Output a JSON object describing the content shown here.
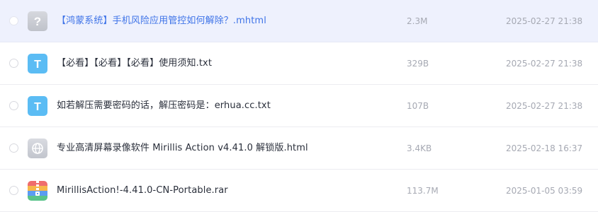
{
  "files": [
    {
      "name": "【鸿蒙系统】手机风险应用管控如何解除？.mhtml",
      "size": "2.3M",
      "date": "2025-02-27 21:38",
      "icon": "unknown-file-icon",
      "selected": true
    },
    {
      "name": "【必看】【必看】【必看】使用须知.txt",
      "size": "329B",
      "date": "2025-02-27 21:38",
      "icon": "text-file-icon",
      "selected": false
    },
    {
      "name": "如若解压需要密码的话，解压密码是：erhua.cc.txt",
      "size": "107B",
      "date": "2025-02-27 21:38",
      "icon": "text-file-icon",
      "selected": false
    },
    {
      "name": "专业高清屏幕录像软件 Mirillis Action v4.41.0 解锁版.html",
      "size": "3.4KB",
      "date": "2025-02-18 16:37",
      "icon": "web-file-icon",
      "selected": false
    },
    {
      "name": "MirillisAction!-4.41.0-CN-Portable.rar",
      "size": "113.7M",
      "date": "2025-01-05 03:59",
      "icon": "archive-file-icon",
      "selected": false
    }
  ],
  "icon_glyphs": {
    "unknown": "?",
    "text": "T"
  },
  "colors": {
    "selected_row_bg": "#eef1fd",
    "selected_name": "#3f74e8",
    "text_icon": "#5bbcf4",
    "meta_text": "#a6a9b3"
  }
}
